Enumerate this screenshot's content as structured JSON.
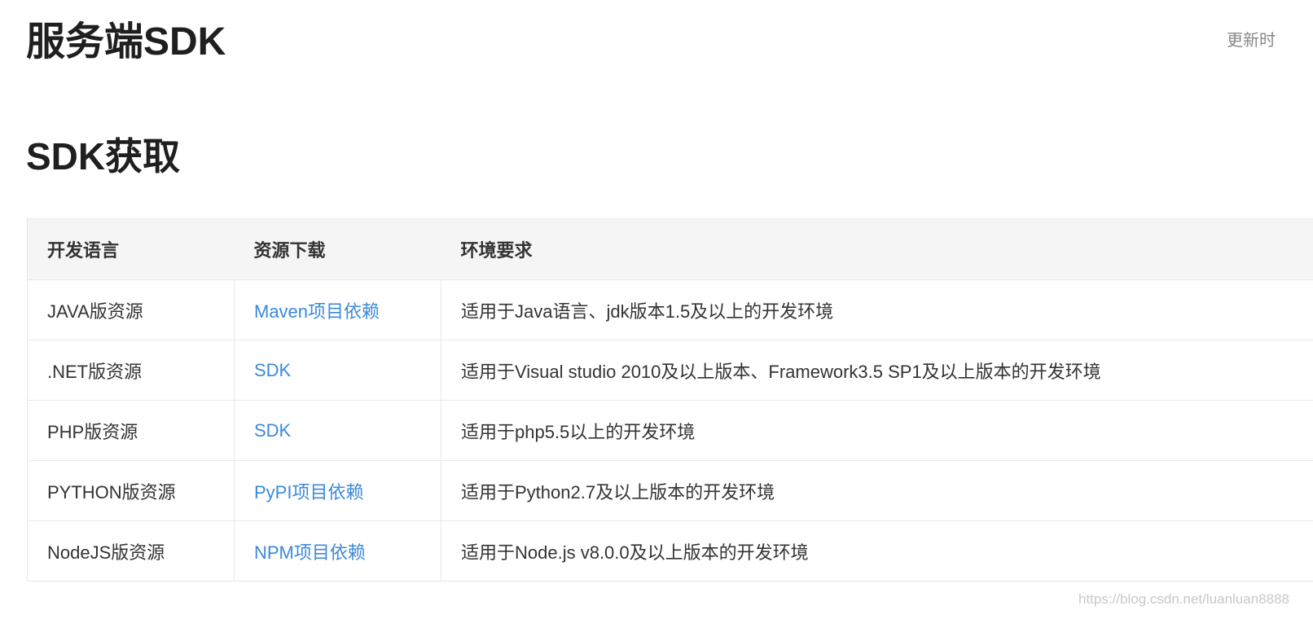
{
  "header": {
    "title": "服务端SDK",
    "update_label": "更新时"
  },
  "section": {
    "title": "SDK获取"
  },
  "table": {
    "columns": [
      "开发语言",
      "资源下载",
      "环境要求"
    ],
    "rows": [
      {
        "language": "JAVA版资源",
        "download": "Maven项目依赖",
        "requirement": "适用于Java语言、jdk版本1.5及以上的开发环境"
      },
      {
        "language": ".NET版资源",
        "download": "SDK",
        "requirement": "适用于Visual studio 2010及以上版本、Framework3.5 SP1及以上版本的开发环境"
      },
      {
        "language": "PHP版资源",
        "download": "SDK",
        "requirement": "适用于php5.5以上的开发环境"
      },
      {
        "language": "PYTHON版资源",
        "download": "PyPI项目依赖",
        "requirement": "适用于Python2.7及以上版本的开发环境"
      },
      {
        "language": "NodeJS版资源",
        "download": "NPM项目依赖",
        "requirement": "适用于Node.js v8.0.0及以上版本的开发环境"
      }
    ]
  },
  "watermark": "https://blog.csdn.net/luanluan8888",
  "colors": {
    "link": "#3b8ad9",
    "header_bg": "#f5f5f5",
    "text": "#333333"
  }
}
